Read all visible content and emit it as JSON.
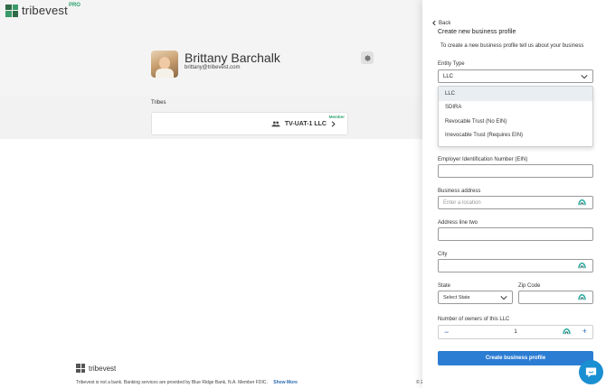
{
  "brand": {
    "name": "tribevest",
    "badge": "PRO"
  },
  "profile": {
    "name": "Brittany Barchalk",
    "email": "brittany@tribevest.com"
  },
  "tribes": {
    "label": "Tribes",
    "card": {
      "badge": "Member",
      "name": "TV-UAT-1 LLC"
    }
  },
  "footer": {
    "brand": "tribevest",
    "disclaimer": "Tribevest is not a bank. Banking services are provided by Blue Ridge Bank, N.A. Member FDIC.",
    "show_more": "Show More",
    "copyright_fragment": "© 2"
  },
  "panel": {
    "back_label": "Back",
    "title": "Create new business profile",
    "description": "To create a new business profile tell us about your business",
    "entity_type": {
      "label": "Entity Type",
      "selected": "LLC",
      "options": [
        "LLC",
        "SDIRA",
        "Revocable Trust (No EIN)",
        "Irrevocable Trust (Requires EIN)"
      ]
    },
    "ein": {
      "label": "Employer Identification Number (EIN)",
      "value": ""
    },
    "business_address": {
      "label": "Business address",
      "placeholder": "Enter a location"
    },
    "address_line_two": {
      "label": "Address line two",
      "value": ""
    },
    "city": {
      "label": "City",
      "value": ""
    },
    "state": {
      "label": "State",
      "selected": "Select State"
    },
    "zip": {
      "label": "Zip Code",
      "value": ""
    },
    "owners": {
      "label": "Number of owners of this LLC",
      "value": "1"
    },
    "submit_label": "Create business profile"
  },
  "colors": {
    "accent": "#2b7cd3",
    "brand_green": "#2ea26f",
    "hero_bg": "#f4f4f4",
    "autofill_icon": "#1aa39a"
  },
  "icons": {
    "back": "chevron-left-icon",
    "settings": "gear-icon",
    "group": "group-icon",
    "tribe_open": "chevron-right-icon",
    "select": "chevron-down-icon",
    "autofill": "autofill-icon",
    "chat": "chat-icon"
  }
}
